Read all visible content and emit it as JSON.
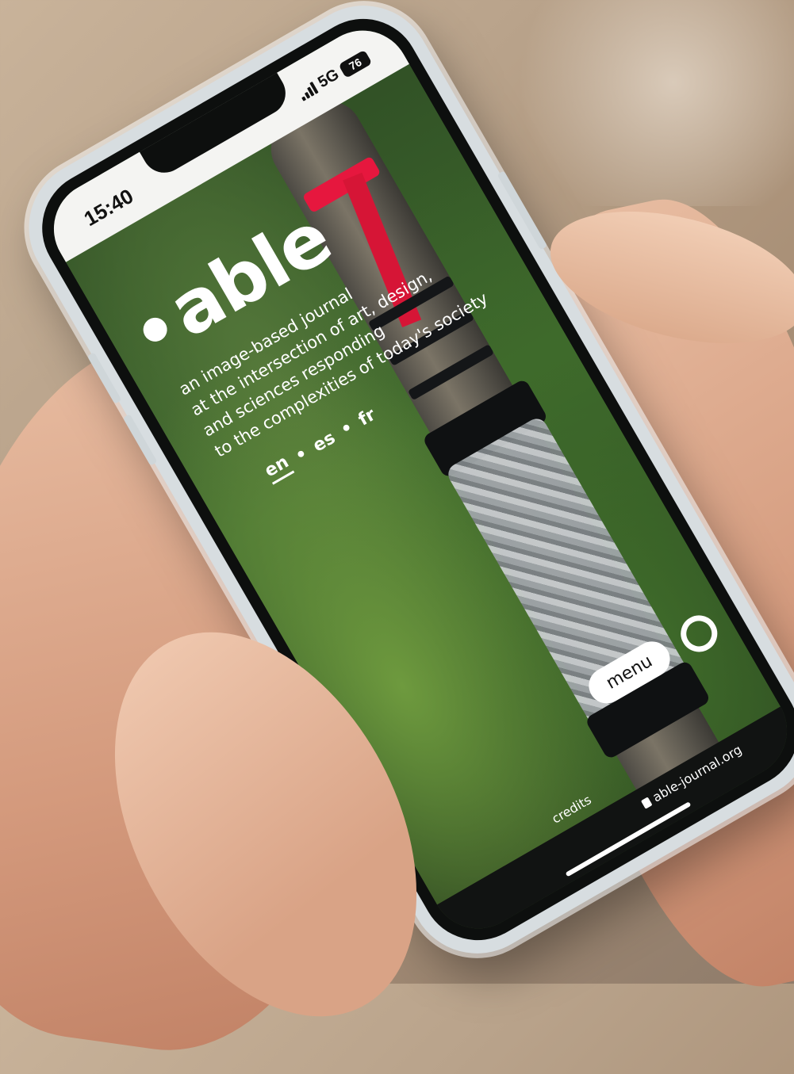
{
  "status": {
    "time": "15:40",
    "network": "5G",
    "battery": "76"
  },
  "app": {
    "logo": "able",
    "tagline": [
      "an image-based journal",
      "at the intersection of art, design,",
      "and sciences responding",
      "to the complexities of today's society"
    ],
    "languages": {
      "en": "en",
      "es": "es",
      "fr": "fr",
      "separator": "•"
    },
    "menu_label": "menu",
    "credits_label": "credits"
  },
  "browser": {
    "url": "able-journal.org"
  }
}
